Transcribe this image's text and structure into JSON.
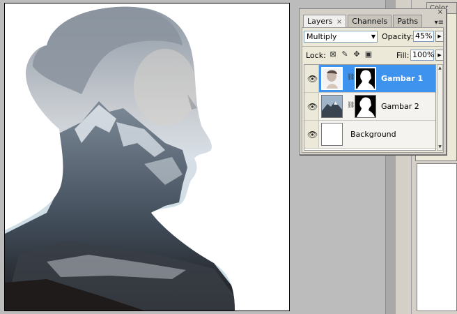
{
  "canvas": {
    "description_icon": "double-exposure-woman-mountains"
  },
  "color_panel": {
    "tab_label": "Color"
  },
  "panel": {
    "close_glyph": "×",
    "tabs": [
      {
        "label": "Layers",
        "close": "×"
      },
      {
        "label": "Channels"
      },
      {
        "label": "Paths"
      }
    ],
    "menu_glyph": "▾≡",
    "blend_mode": "Multiply",
    "opacity_label": "Opacity:",
    "opacity_value": "45%",
    "lock_label": "Lock:",
    "fill_label": "Fill:",
    "fill_value": "100%",
    "layers": [
      {
        "name": "Gambar 1",
        "selected": true
      },
      {
        "name": "Gambar 2",
        "selected": false
      },
      {
        "name": "Background",
        "selected": false
      }
    ]
  },
  "colors": {
    "selection": "#3d93ee",
    "panel_bg": "#d4d0c8"
  }
}
